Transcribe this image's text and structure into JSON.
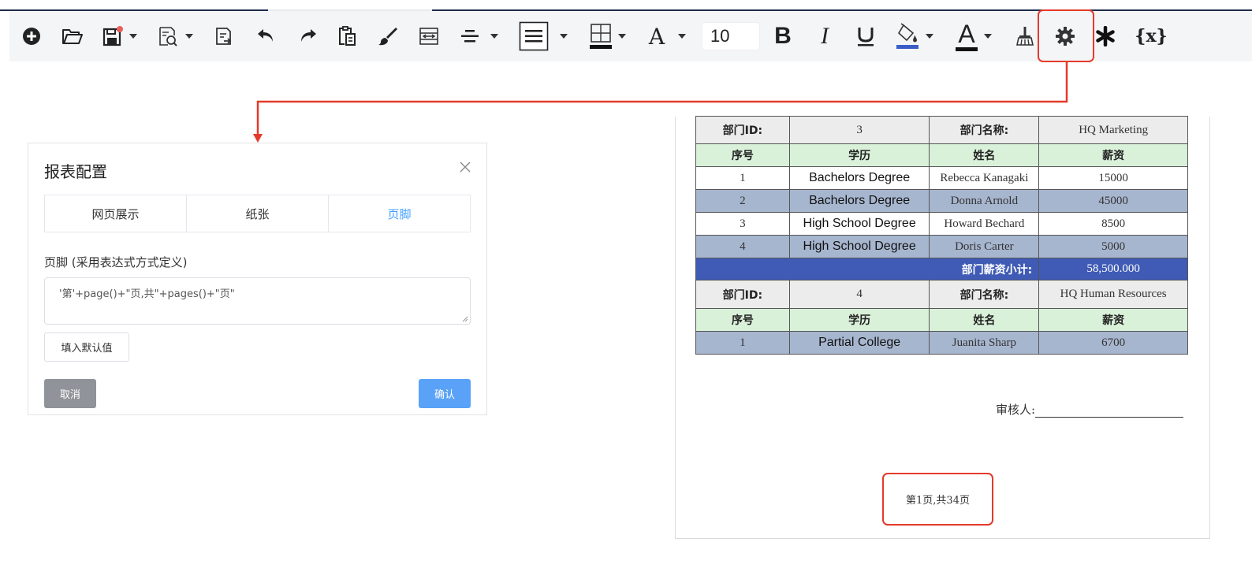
{
  "toolbar": {
    "font_size": "10",
    "icons": [
      "add-icon",
      "open-folder-icon",
      "save-icon",
      "preview-icon",
      "import-icon",
      "undo-icon",
      "redo-icon",
      "paste-icon",
      "format-brush-icon",
      "merge-cells-icon",
      "align-icon",
      "line-style-icon",
      "border-icon",
      "font-icon",
      "bold-icon",
      "italic-icon",
      "underline-icon",
      "fill-color-icon",
      "font-color-icon",
      "clear-format-icon",
      "settings-icon",
      "asterisk-icon",
      "variable-icon"
    ],
    "variable_label": "{x}",
    "bold_label": "B",
    "italic_label": "I",
    "underline_label": "U",
    "font_label": "A",
    "font_color_label": "A",
    "fill_color": "#3b5ec6",
    "font_color": "#111111",
    "highlight_color": "#e53a2a"
  },
  "dialog": {
    "title": "报表配置",
    "tabs": [
      {
        "label": "网页展示",
        "active": false
      },
      {
        "label": "纸张",
        "active": false
      },
      {
        "label": "页脚",
        "active": true
      }
    ],
    "field_label": "页脚 (采用表达式方式定义)",
    "footer_expression": "'第'+page()+\"页,共\"+pages()+\"页\"",
    "fill_default_label": "填入默认值",
    "cancel_label": "取消",
    "confirm_label": "确认",
    "accent_color": "#409eff"
  },
  "report": {
    "groups": [
      {
        "dept_id_label": "部门ID:",
        "dept_id": "3",
        "dept_name_label": "部门名称:",
        "dept_name": "HQ Marketing",
        "columns": [
          "序号",
          "学历",
          "姓名",
          "薪资"
        ],
        "rows": [
          {
            "no": "1",
            "education": "Bachelors Degree",
            "name": "Rebecca Kanagaki",
            "salary": "15000"
          },
          {
            "no": "2",
            "education": "Bachelors Degree",
            "name": "Donna Arnold",
            "salary": "45000"
          },
          {
            "no": "3",
            "education": "High School Degree",
            "name": "Howard Bechard",
            "salary": "8500"
          },
          {
            "no": "4",
            "education": "High School Degree",
            "name": "Doris Carter",
            "salary": "5000"
          }
        ],
        "subtotal_label": "部门薪资小计:",
        "subtotal": "58,500.000"
      },
      {
        "dept_id_label": "部门ID:",
        "dept_id": "4",
        "dept_name_label": "部门名称:",
        "dept_name": "HQ Human Resources",
        "columns": [
          "序号",
          "学历",
          "姓名",
          "薪资"
        ],
        "rows": [
          {
            "no": "1",
            "education": "Partial College",
            "name": "Juanita Sharp",
            "salary": "6700"
          }
        ]
      }
    ],
    "auditor_label": "审核人:",
    "page_footer": "第1页,共34页"
  }
}
